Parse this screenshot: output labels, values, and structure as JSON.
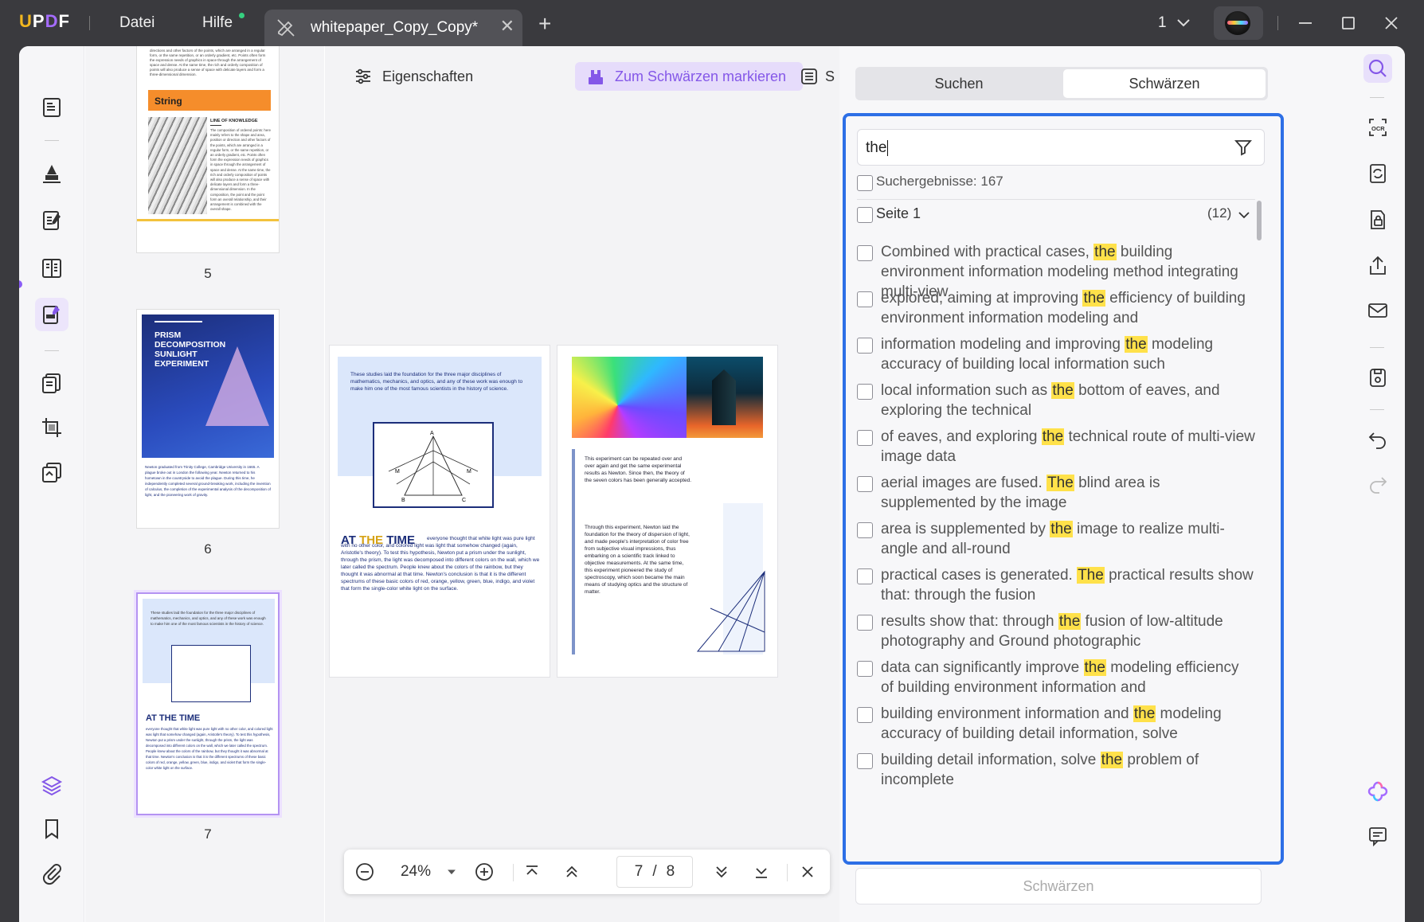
{
  "app": {
    "logo": "UPDF",
    "menu": {
      "file": "Datei",
      "help": "Hilfe"
    },
    "tab": {
      "title": "whitepaper_Copy_Copy*"
    },
    "page_indicator": "1"
  },
  "colors": {
    "accent": "#8457e8",
    "highlight": "#ffe14a",
    "focus_border": "#2d6fe6",
    "titlebar": "#3a3a3e"
  },
  "toolbar": {
    "properties_label": "Eigenschaften",
    "mark_redact_label": "Zum Schwärzen markieren",
    "more_label": "S"
  },
  "thumbnails": [
    {
      "page": "5",
      "banner": "String",
      "heading": "LINE OF KNOWLEDGE"
    },
    {
      "page": "6",
      "title": "PRISM DECOMPOSITION SUNLIGHT EXPERIMENT"
    },
    {
      "page": "7",
      "heading": "AT THE TIME"
    }
  ],
  "pages": {
    "left": {
      "intro": "These studies laid the foundation for the three major disciplines of mathematics, mechanics, and optics, and any of these work was enough to make him one of the most famous scientists in the history of science.",
      "heading_a": "AT ",
      "heading_b": "THE",
      "heading_c": " TIME",
      "body": "everyone thought that white light was pure light with no other color, and colored light was light that somehow changed (again, Aristotle's theory). To test this hypothesis, Newton put a prism under the sunlight, through the prism, the light was decomposed into different colors on the wall, which we later called the spectrum. People knew about the colors of the rainbow, but they thought it was abnormal at that time. Newton's conclusion is that it is the different spectrums of these basic colors of red, orange, yellow, green, blue, indigo, and violet that form the single-color white light on the surface."
    },
    "right": {
      "para1": "This experiment can be repeated over and over again and get the same experimental results as Newton. Since then, the theory of the seven colors has been generally accepted.",
      "para2": "Through this experiment, Newton laid the foundation for the theory of dispersion of light, and made people's interpretation of color free from subjective visual impressions, thus embarking on a scientific track linked to objective measurements. At the same time, this experiment pioneered the study of spectroscopy, which soon became the main means of studying optics and the structure of matter."
    }
  },
  "zoom": {
    "value": "24%",
    "current_page": "7",
    "separator": "/",
    "total_pages": "8"
  },
  "panel": {
    "tabs": {
      "search": "Suchen",
      "redact": "Schwärzen"
    },
    "query": "the",
    "results_count_label": "Suchergebnisse: 167",
    "page_group": {
      "label": "Seite 1",
      "count": "(12)"
    },
    "results": [
      {
        "pre": "Combined with practical cases, ",
        "hit": "the",
        "post": " building environment information modeling method integrating multi-view"
      },
      {
        "pre": "explored, aiming at improving ",
        "hit": "the",
        "post": " efficiency of building environment information modeling and"
      },
      {
        "pre": "information modeling and improving ",
        "hit": "the",
        "post": " modeling accuracy of building local information such"
      },
      {
        "pre": "local information such as ",
        "hit": "the",
        "post": " bottom of eaves, and exploring the technical"
      },
      {
        "pre": "of eaves, and exploring ",
        "hit": "the",
        "post": " technical route of multi-view image data"
      },
      {
        "pre": "aerial images are fused. ",
        "hit": "The",
        "post": " blind area is supplemented by the image"
      },
      {
        "pre": "area is supplemented by ",
        "hit": "the",
        "post": " image to realize multi-angle and all-round"
      },
      {
        "pre": "practical cases is generated. ",
        "hit": "The",
        "post": " practical results show that: through the fusion"
      },
      {
        "pre": "results show that: through ",
        "hit": "the",
        "post": " fusion of low-altitude photography and Ground photographic"
      },
      {
        "pre": "data can significantly improve ",
        "hit": "the",
        "post": " modeling efficiency of building environment information and"
      },
      {
        "pre": "building environment information and ",
        "hit": "the",
        "post": " modeling accuracy of building detail information, solve"
      },
      {
        "pre": "building detail information, solve ",
        "hit": "the",
        "post": " problem of incomplete"
      }
    ],
    "redact_button": "Schwärzen"
  }
}
